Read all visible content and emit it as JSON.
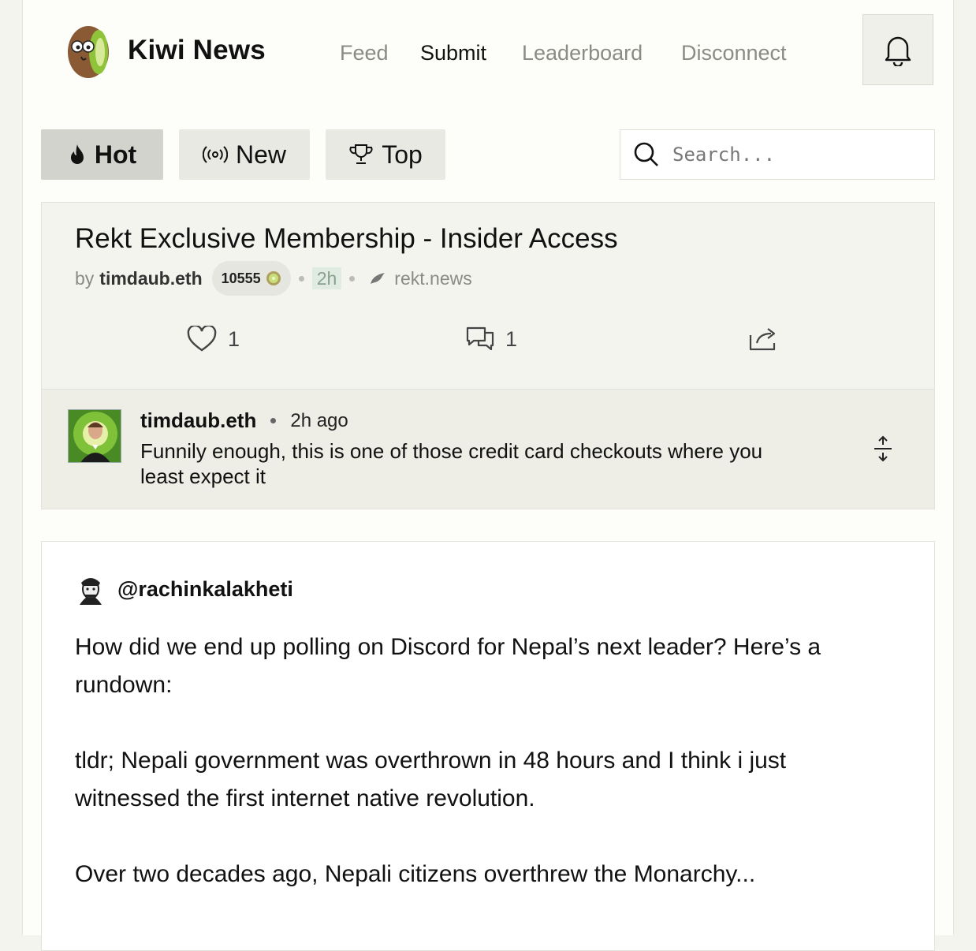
{
  "header": {
    "brand": "Kiwi News",
    "nav": [
      "Feed",
      "Submit",
      "Leaderboard",
      "Disconnect"
    ],
    "active_nav": "Submit",
    "icons": {
      "logo": "kiwi-logo",
      "bell": "bell-icon"
    }
  },
  "tabs": [
    {
      "label": "Hot",
      "icon": "flame-icon",
      "active": true
    },
    {
      "label": "New",
      "icon": "broadcast-icon",
      "active": false
    },
    {
      "label": "Top",
      "icon": "trophy-icon",
      "active": false
    }
  ],
  "search": {
    "placeholder": "Search..."
  },
  "story": {
    "title": "Rekt Exclusive Membership - Insider Access",
    "by": "by",
    "author": "timdaub.eth",
    "karma": "10555",
    "age": "2h",
    "domain": "rekt.news",
    "likes": "1",
    "comments": "1"
  },
  "comment": {
    "user": "timdaub.eth",
    "time": "2h ago",
    "text": "Funnily enough, this is one of those credit card checkouts where you least expect it"
  },
  "cast": {
    "handle": "@rachinkalakheti",
    "paragraphs": [
      "How did we end up polling on Discord for Nepal’s next leader? Here’s a rundown:",
      "tldr; Nepali government was overthrown in 48 hours and I think i just witnessed the first internet native revolution.",
      "Over two decades ago, Nepali citizens overthrew the Monarchy..."
    ]
  },
  "colors": {
    "page": "#fdfdf9",
    "card": "#f4f4ef",
    "active_tab": "#d3d3ce",
    "tab": "#e9e9e4",
    "age_badge": "#e0ebe2"
  }
}
